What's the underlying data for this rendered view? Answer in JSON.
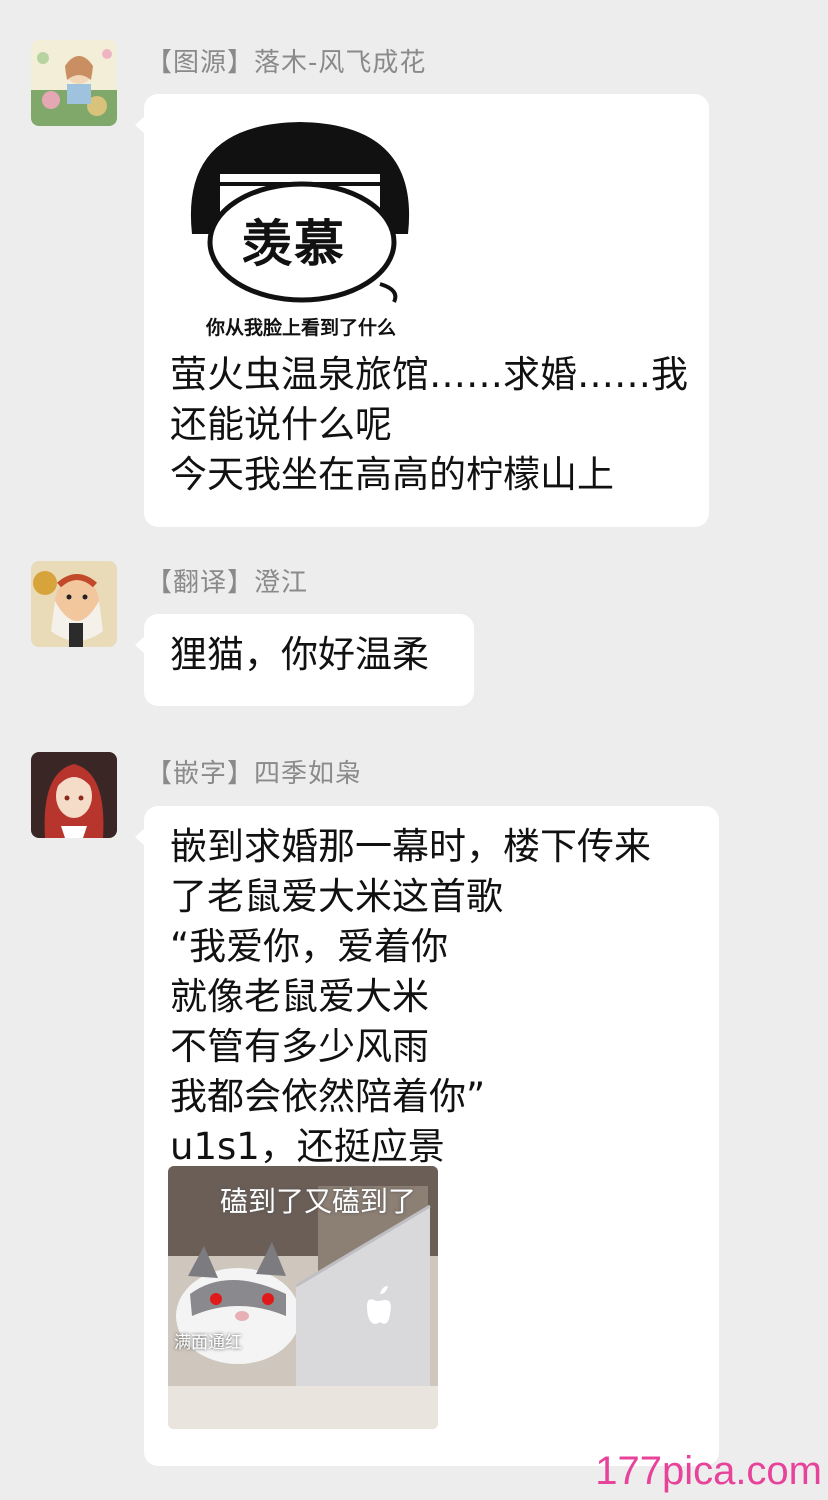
{
  "messages": [
    {
      "sender": "【图源】落木-风飞成花",
      "sticker": {
        "title": "羡慕",
        "caption": "你从我脸上看到了什么"
      },
      "lines": [
        "萤火虫温泉旅馆……求婚……我",
        "还能说什么呢",
        "今天我坐在高高的柠檬山上"
      ]
    },
    {
      "sender": "【翻译】澄江",
      "lines": [
        "狸猫，你好温柔"
      ]
    },
    {
      "sender": "【嵌字】四季如枭",
      "lines": [
        "嵌到求婚那一幕时，楼下传来",
        "了老鼠爱大米这首歌",
        "“我爱你，爱着你",
        "就像老鼠爱大米",
        "不管有多少风雨",
        "我都会依然陪着你”",
        "u1s1，还挺应景"
      ],
      "sticker": {
        "title": "磕到了又磕到了",
        "caption": "满面通红"
      }
    }
  ],
  "watermark": "177pica.com",
  "colors": {
    "background": "#ededed",
    "bubble": "#ffffff",
    "watermark": "#e8439a"
  }
}
